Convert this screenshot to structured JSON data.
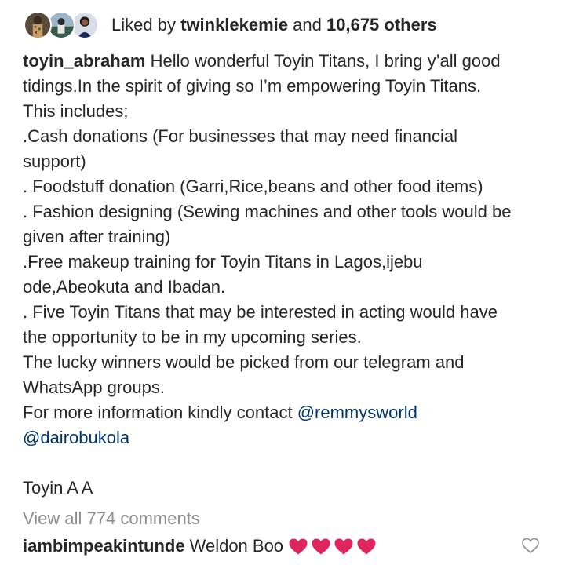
{
  "likes": {
    "prefix": "Liked by",
    "first_user": "twinklekemie",
    "and": "and",
    "others": "10,675 others"
  },
  "caption": {
    "username": "toyin_abraham",
    "line1_rest": "Hello wonderful Toyin Titans, I bring y’all good",
    "line2": "tidings.In the spirit of giving so  I’m empowering Toyin Titans.",
    "line3": "This includes;",
    "line4": ".Cash donations (For businesses that may need financial",
    "line5": "support)",
    "line6": ". Foodstuff donation (Garri,Rice,beans and other food items)",
    "line7": ". Fashion designing (Sewing machines and other tools would be",
    "line8": "given after training)",
    "line9": ".Free makeup training for Toyin Titans in Lagos,ijebu",
    "line10": "ode,Abeokuta and Ibadan.",
    "line11": ". Five Toyin Titans that may be  interested in acting would have",
    "line12": "the opportunity to be in my upcoming series.",
    "line13": "The lucky winners would be picked from our telegram and",
    "line14": "WhatsApp groups.",
    "line15": "For more information kindly contact",
    "mention1": "@remmysworld",
    "mention2": "@dairobukola",
    "signoff": "Toyin A A"
  },
  "view_all_comments": "View all 774 comments",
  "comment": {
    "username": "iambimpeakintunde",
    "text": "Weldon Boo",
    "emoji_hearts": 4
  },
  "colors": {
    "text": "#262626",
    "mention": "#003569",
    "muted": "#8e8e8e",
    "heart": "#e0245e"
  },
  "icons": {
    "comment_like": "heart-outline-icon"
  }
}
